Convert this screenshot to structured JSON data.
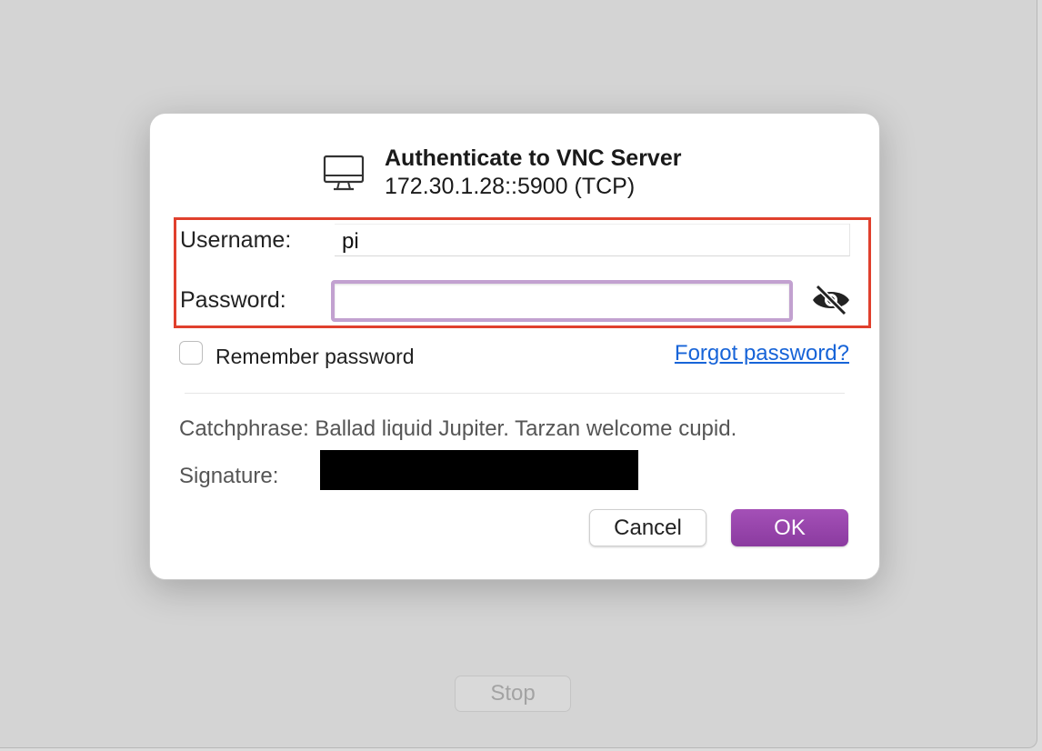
{
  "background": {
    "stop_label": "Stop"
  },
  "dialog": {
    "title": "Authenticate to VNC Server",
    "subtitle": "172.30.1.28::5900 (TCP)",
    "username_label": "Username:",
    "username_value": "pi",
    "password_label": "Password:",
    "password_value": "",
    "remember_label": "Remember password",
    "remember_checked": false,
    "forgot_link": "Forgot password?",
    "catchphrase": "Catchphrase: Ballad liquid Jupiter. Tarzan welcome cupid.",
    "signature_label": "Signature:",
    "cancel_label": "Cancel",
    "ok_label": "OK"
  },
  "icons": {
    "header": "monitor-icon",
    "password_visibility": "eye-slash-icon"
  },
  "colors": {
    "accent": "#9644aa",
    "highlight": "#e0402d",
    "link": "#1764d8"
  }
}
